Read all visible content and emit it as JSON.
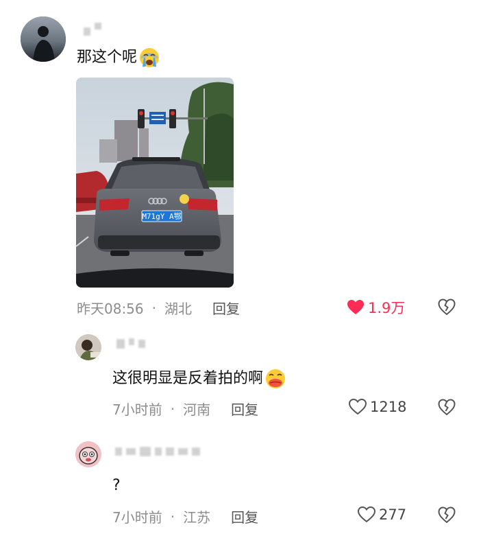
{
  "comments": [
    {
      "text": "那这个呢",
      "emoji": "crying-face-emoji",
      "time": "昨天08:56",
      "separator": "·",
      "location": "湖北",
      "reply_label": "回复",
      "likes": "1.9万",
      "liked": true,
      "image": {
        "plate_text": "M71gY A鄂"
      }
    },
    {
      "text": "这很明显是反着拍的啊",
      "emoji": "kissing-face-emoji",
      "time": "7小时前",
      "separator": "·",
      "location": "河南",
      "reply_label": "回复",
      "likes": "1218",
      "liked": false
    },
    {
      "text": "?",
      "time": "7小时前",
      "separator": "·",
      "location": "江苏",
      "reply_label": "回复",
      "likes": "277",
      "liked": false
    }
  ],
  "colors": {
    "like_active": "#fe2c55",
    "meta_text": "#8c8c8c",
    "reply_text": "#555555"
  }
}
